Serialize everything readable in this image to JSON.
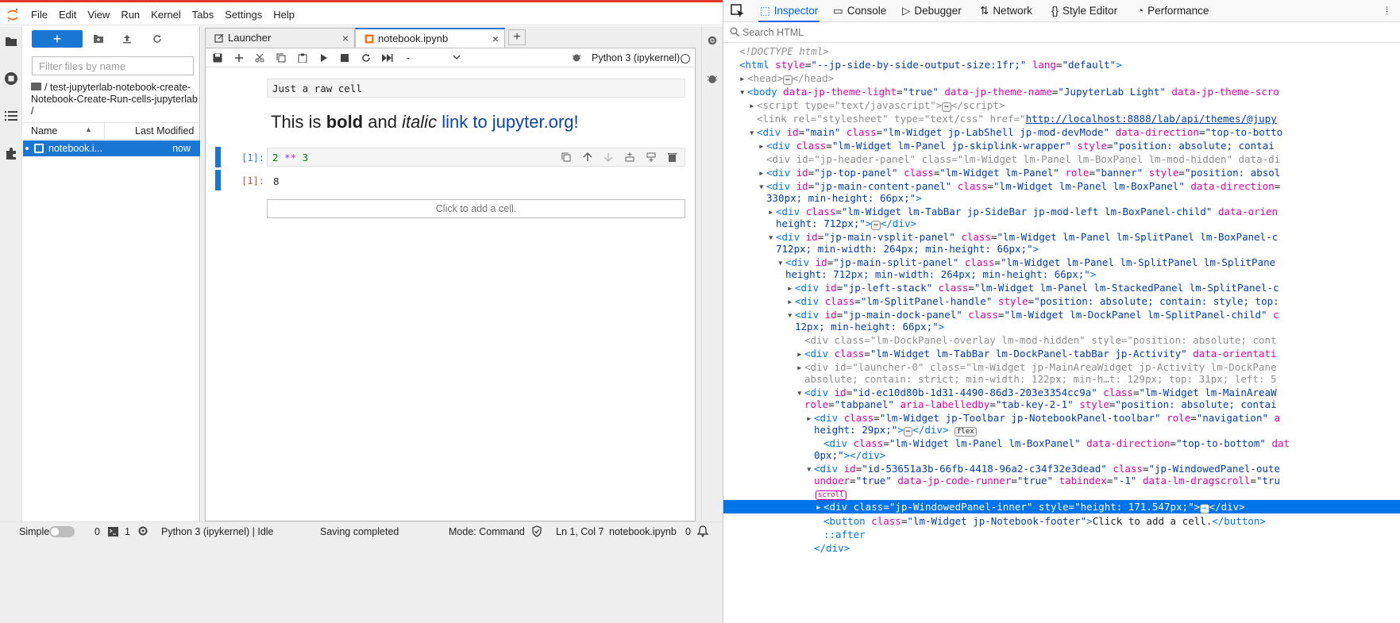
{
  "menu": [
    "File",
    "Edit",
    "View",
    "Run",
    "Kernel",
    "Tabs",
    "Settings",
    "Help"
  ],
  "filebrowser": {
    "new_label": "+",
    "filter_placeholder": "Filter files by name",
    "breadcrumb": "/ test-jupyterlab-notebook-create-Notebook-Create-Run-cells-jupyterlab /",
    "col_name": "Name",
    "col_modified": "Last Modified",
    "files": [
      {
        "name": "notebook.i...",
        "modified": "now"
      }
    ]
  },
  "tabs": [
    {
      "label": "Launcher",
      "close": "×"
    },
    {
      "label": "notebook.ipynb",
      "close": "×"
    }
  ],
  "tab_add": "+",
  "notebook": {
    "cell_type": "-",
    "kernel": "Python 3 (ipykernel)",
    "raw_cell": "Just a raw cell",
    "markdown": {
      "pre": "This is ",
      "bold": "bold",
      "mid1": " and ",
      "italic": "italic",
      "mid2": " ",
      "link": "link to jupyter.org!"
    },
    "code_prompt": "[1]:",
    "code": {
      "a": "2",
      "op": "**",
      "b": "3"
    },
    "output_prompt": "[1]:",
    "output": "8",
    "add_cell": "Click to add a cell."
  },
  "status": {
    "mode_label": "Simple",
    "terminals": "0",
    "kernels": "1",
    "kernel_status": "Python 3 (ipykernel) | Idle",
    "save": "Saving completed",
    "mode": "Mode: Command",
    "position": "Ln 1, Col 7",
    "file": "notebook.ipynb",
    "notifications": "0"
  },
  "devtools": {
    "tabs": [
      "Inspector",
      "Console",
      "Debugger",
      "Network",
      "Style Editor",
      "Performance"
    ],
    "search_placeholder": "Search HTML"
  }
}
